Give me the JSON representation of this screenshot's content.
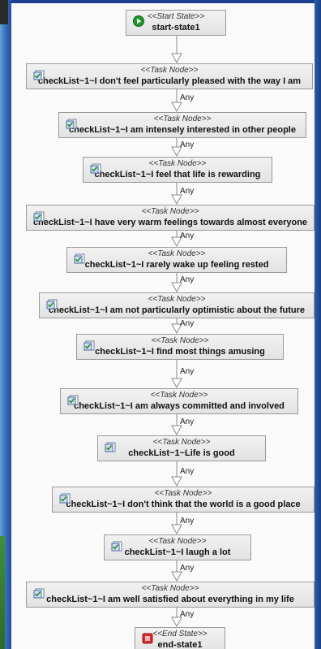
{
  "diagram": {
    "start": {
      "stereotype": "<<Start State>>",
      "name": "start-state1"
    },
    "task_stereotype": "<<Task Node>>",
    "tasks": [
      "checkList~1~I don't feel particularly pleased with the way I am",
      "checkList~1~I am intensely interested in other people",
      "checkList~1~I feel that life is rewarding",
      "checkList~1~I have very warm feelings towards almost everyone",
      "checkList~1~I rarely wake up feeling rested",
      "checkList~1~I am not particularly optimistic about the future",
      "checkList~1~I find most things amusing",
      "checkList~1~I am always committed and involved",
      "checkList~1~Life is good",
      "checkList~1~I don't think that the world is a good place",
      "checkList~1~I laugh a lot",
      "checkList~1~I am well satisfied about everything in my life"
    ],
    "end": {
      "stereotype": "<<End State>>",
      "name": "end-state1"
    },
    "transition_label": "Any",
    "icons": {
      "start": "start-play-icon",
      "task": "task-checklist-icon",
      "end": "end-stop-icon"
    },
    "colors": {
      "node_fill": "#e8e8e8",
      "node_border": "#9a9a9a",
      "edge": "#8a8a8a",
      "start_icon": "#1f9a2a",
      "end_icon": "#d92b2b"
    }
  }
}
